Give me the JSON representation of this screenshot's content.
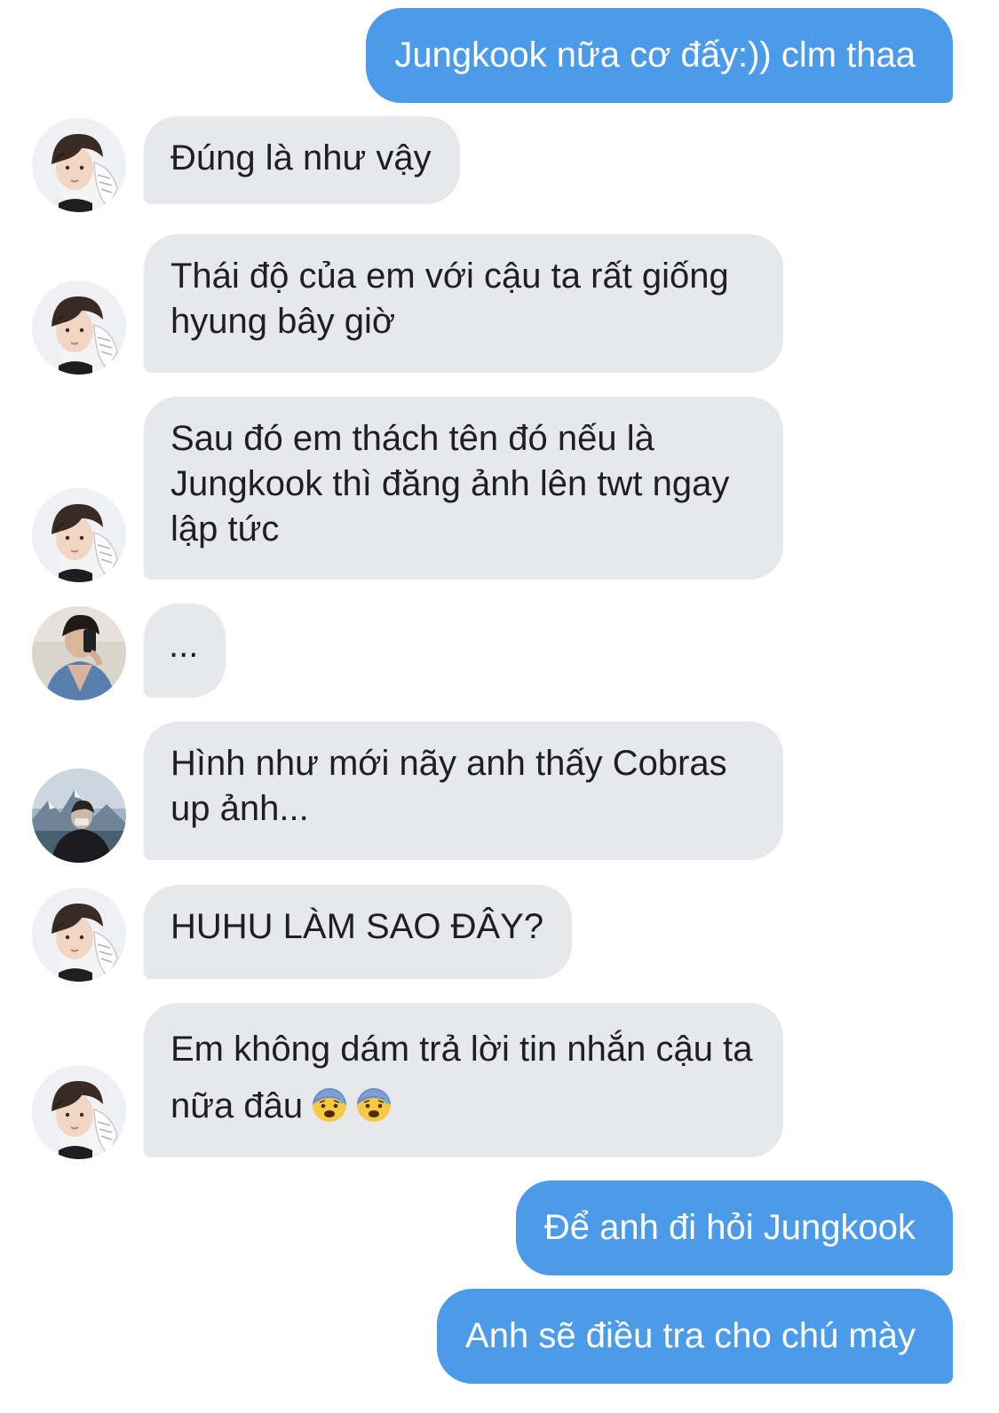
{
  "conversation": {
    "messages": [
      {
        "id": "m1",
        "side": "out",
        "text": "Jungkook nữa cơ đấy:)) clm thaa"
      },
      {
        "id": "m2",
        "side": "in",
        "avatar": "avatar-boy-hand",
        "text": "Đúng là như vậy"
      },
      {
        "id": "m3",
        "side": "in",
        "avatar": "avatar-boy-hand",
        "text": "Thái độ của em với cậu ta rất giống hyung bây giờ"
      },
      {
        "id": "m4",
        "side": "in",
        "avatar": "avatar-boy-hand",
        "text": "Sau đó em thách tên đó nếu là Jungkook thì đăng ảnh lên twt ngay lập tức"
      },
      {
        "id": "m5",
        "side": "in",
        "avatar": "avatar-mirror-selfie",
        "text": "..."
      },
      {
        "id": "m6",
        "side": "in",
        "avatar": "avatar-mountain",
        "text": "Hình như mới nãy anh thấy Cobras up ảnh..."
      },
      {
        "id": "m7",
        "side": "in",
        "avatar": "avatar-boy-hand",
        "text": "HUHU LÀM SAO ĐÂY?"
      },
      {
        "id": "m8",
        "side": "in",
        "avatar": "avatar-boy-hand",
        "text": "Em không dám trả lời tin nhắn cậu ta nữa đâu",
        "emojis": [
          "anxious-face-with-sweat-icon",
          "anxious-face-with-sweat-icon"
        ]
      },
      {
        "id": "m9",
        "side": "out",
        "text": "Để anh đi hỏi Jungkook"
      },
      {
        "id": "m10",
        "side": "out",
        "text": "Anh sẽ điều tra cho chú mày"
      }
    ]
  },
  "colors": {
    "outgoing_bubble": "#4c9be8",
    "incoming_bubble": "#e7e8ec",
    "background": "#ffffff"
  }
}
